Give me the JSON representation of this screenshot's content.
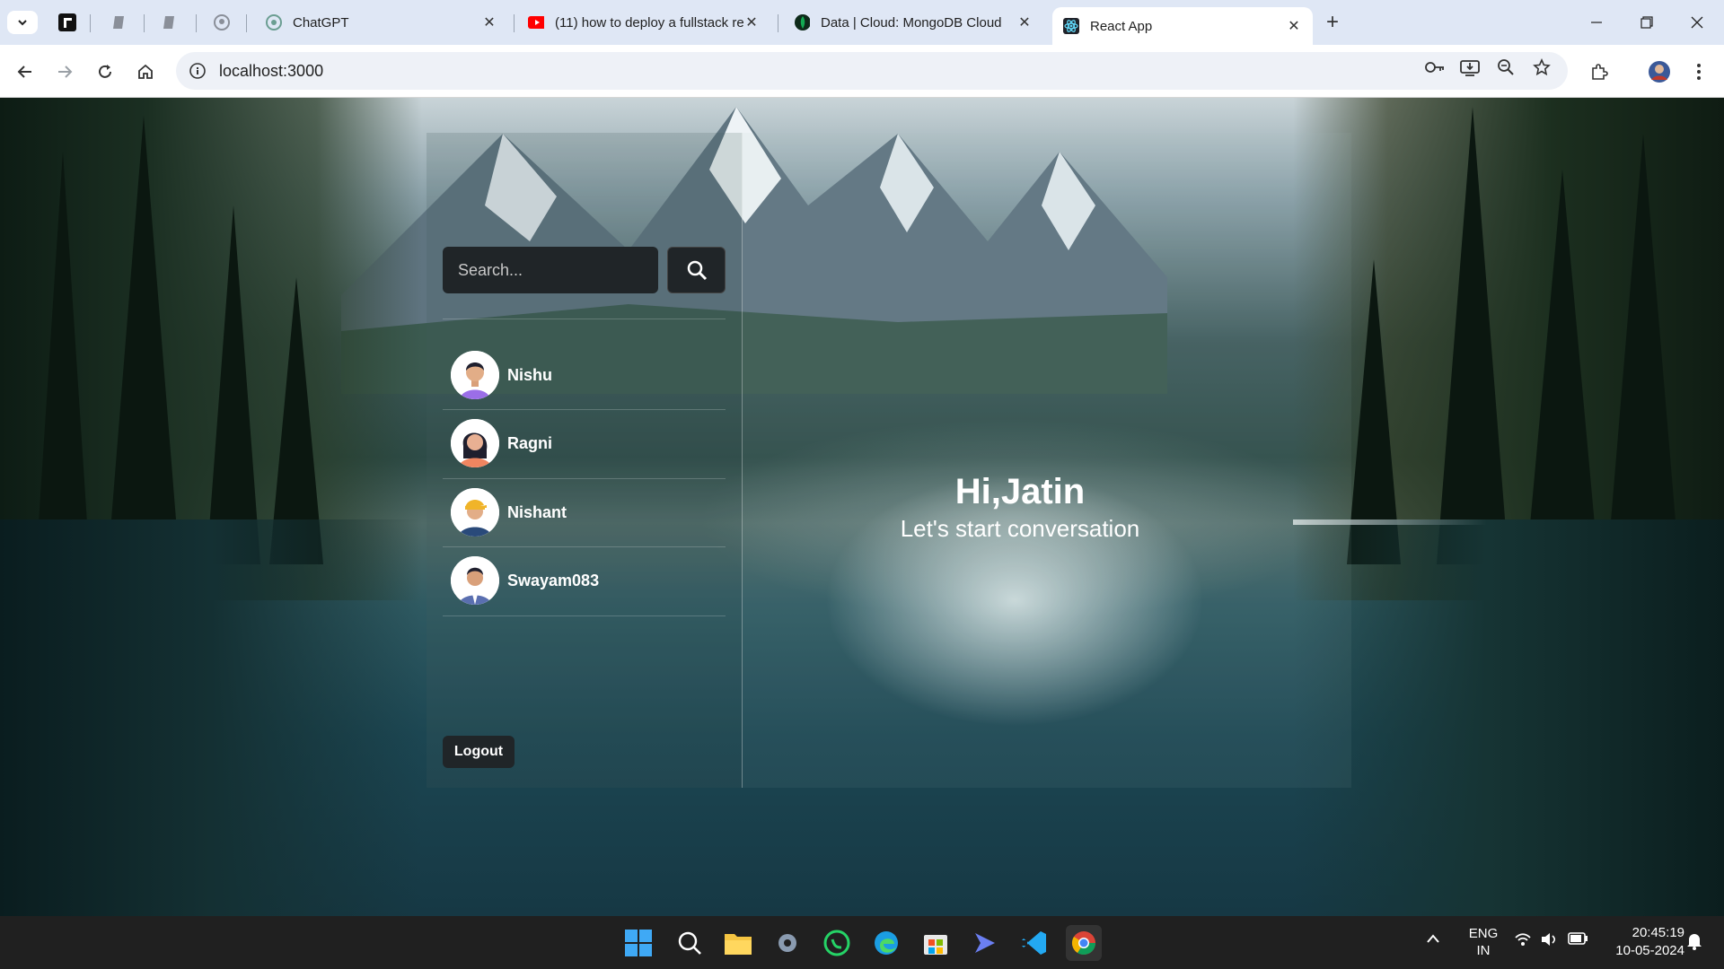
{
  "browser": {
    "tabs": [
      {
        "title": "ChatGPT",
        "favicon": "chatgpt-icon"
      },
      {
        "title": "(11) how to deploy a fullstack re",
        "favicon": "youtube-icon"
      },
      {
        "title": "Data | Cloud: MongoDB Cloud",
        "favicon": "mongodb-icon"
      },
      {
        "title": "React App",
        "favicon": "react-icon",
        "active": true
      }
    ],
    "new_tab": "+",
    "url": "localhost:3000"
  },
  "app": {
    "search_placeholder": "Search...",
    "users": [
      {
        "name": "Nishu",
        "avatar_color": "#9b6ee8"
      },
      {
        "name": "Ragni",
        "avatar_color": "#f08560"
      },
      {
        "name": "Nishant",
        "avatar_color": "#2a4a7a"
      },
      {
        "name": "Swayam083",
        "avatar_color": "#5a6fb0"
      }
    ],
    "logout_label": "Logout",
    "greeting": "Hi,Jatin",
    "subtitle": "Let's start conversation"
  },
  "taskbar": {
    "lang_top": "ENG",
    "lang_bottom": "IN",
    "time": "20:45:19",
    "date": "10-05-2024"
  }
}
